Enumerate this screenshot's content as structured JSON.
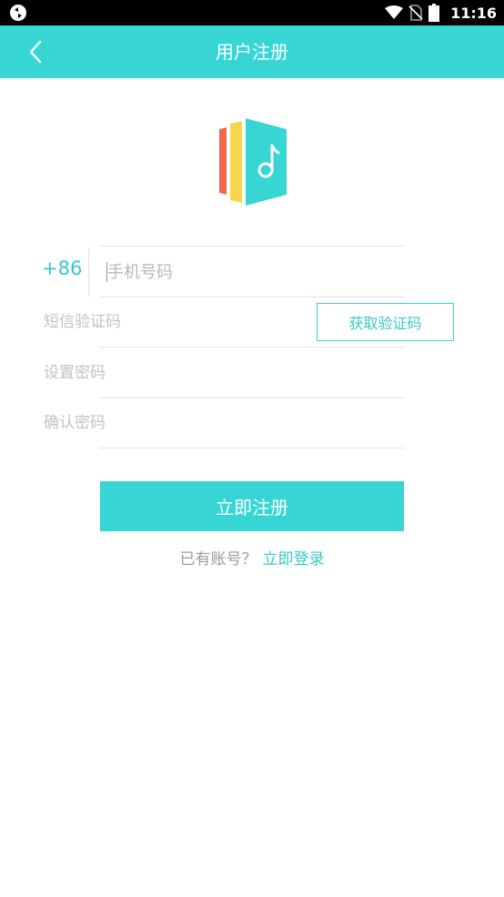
{
  "status_bar": {
    "time": "11:16",
    "icons": [
      "app-notification-icon",
      "wifi-icon",
      "no-sim-icon",
      "battery-icon"
    ]
  },
  "app_bar": {
    "title": "用户注册",
    "back_icon": "chevron-left-icon",
    "background": "#38d5d5"
  },
  "form": {
    "country_code": "+86",
    "phone_placeholder": "手机号码",
    "sms_code_placeholder": "短信验证码",
    "get_code_label": "获取验证码",
    "password_placeholder": "设置密码",
    "confirm_password_placeholder": "确认密码"
  },
  "actions": {
    "register_label": "立即注册",
    "login_prompt": "已有账号？",
    "login_link": "立即登录"
  },
  "colors": {
    "accent": "#38d5d5",
    "logo_red": "#f0674a",
    "logo_yellow": "#f7d64e",
    "logo_teal": "#38d5d5"
  }
}
